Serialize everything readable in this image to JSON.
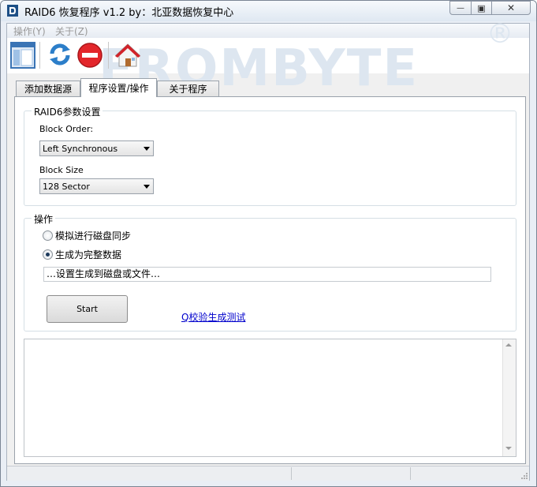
{
  "window": {
    "title": "RAID6 恢复程序 v1.2 by：北亚数据恢复中心",
    "minimize_glyph": "—",
    "maximize_glyph": "▣",
    "close_glyph": "✕"
  },
  "menu": {
    "items": [
      {
        "label": "操作(Y)"
      },
      {
        "label": "关于(Z)"
      }
    ]
  },
  "toolbar": {
    "icons": [
      "window-icon",
      "refresh-icon",
      "stop-icon",
      "home-icon"
    ],
    "watermark": "FROMBYTE",
    "registered_mark": "®"
  },
  "tabs": [
    {
      "label": "添加数据源",
      "active": false
    },
    {
      "label": "程序设置/操作",
      "active": true
    },
    {
      "label": "关于程序",
      "active": false
    }
  ],
  "raid_group": {
    "title": "RAID6参数设置",
    "block_order_label": "Block Order:",
    "block_order_value": "Left Synchronous",
    "block_size_label": "Block Size",
    "block_size_value": "128 Sector"
  },
  "ops_group": {
    "title": "操作",
    "radio_simulate": {
      "label": "模拟进行磁盘同步",
      "checked": false
    },
    "radio_generate": {
      "label": "生成为完整数据",
      "checked": true
    },
    "target_text": "…设置生成到磁盘或文件…",
    "start_label": "Start",
    "verify_link": "Q校验生成测试"
  },
  "log": {
    "text": ""
  },
  "colors": {
    "accent_link": "#0000cc",
    "stop_red": "#e3262b",
    "refresh_blue": "#2c7ec9",
    "home_red": "#d2232a"
  }
}
